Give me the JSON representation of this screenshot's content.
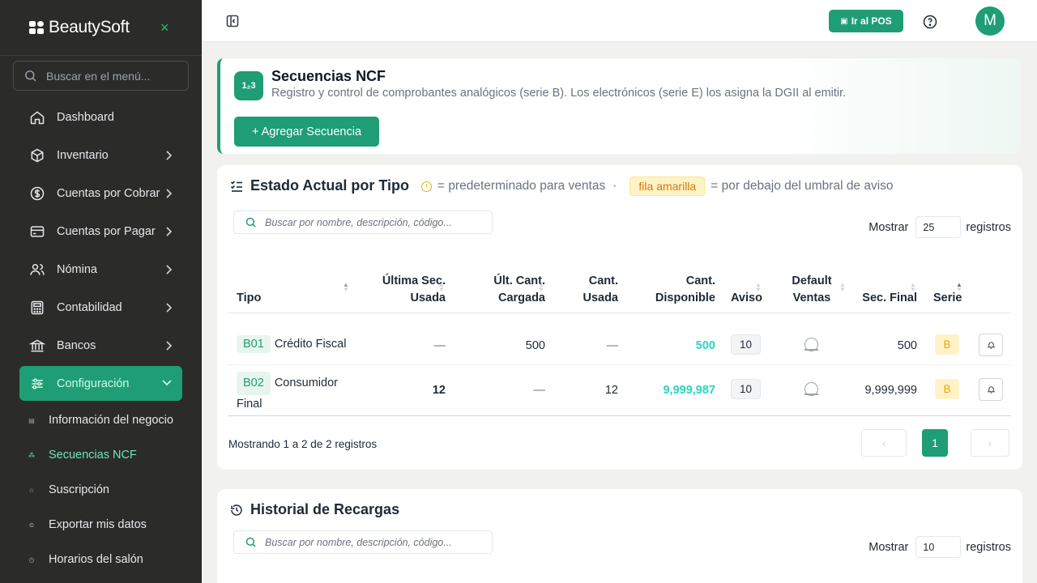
{
  "brand": {
    "name": "BeautySoft",
    "close_glyph": "×"
  },
  "menu_search": {
    "placeholder": "Buscar en el menú..."
  },
  "nav": [
    {
      "label": "Dashboard",
      "icon": "home-icon"
    },
    {
      "label": "Inventario",
      "icon": "box-icon"
    },
    {
      "label": "Cuentas por Cobrar",
      "icon": "dollar-icon"
    },
    {
      "label": "Cuentas por Pagar",
      "icon": "card-icon"
    },
    {
      "label": "Nómina",
      "icon": "users-icon"
    },
    {
      "label": "Contabilidad",
      "icon": "calculator-icon"
    },
    {
      "label": "Bancos",
      "icon": "bank-icon"
    },
    {
      "label": "Configuración",
      "icon": "sliders-icon"
    }
  ],
  "subnav": [
    {
      "label": "Información del negocio",
      "glyph": "▤"
    },
    {
      "label": "Secuencias NCF",
      "glyph": "⁂"
    },
    {
      "label": "Suscripción",
      "glyph": "☆"
    },
    {
      "label": "Exportar mis datos",
      "glyph": "⊜"
    },
    {
      "label": "Horarios del salón",
      "glyph": "◷"
    }
  ],
  "topbar": {
    "pos_label": "Ir al POS",
    "avatar_initial": "M"
  },
  "header": {
    "icon_text": "1₂3",
    "title": "Secuencias NCF",
    "subtitle": "Registro y control de comprobantes analógicos (serie B). Los electrónicos (serie E) los asigna la DGII al emitir.",
    "add_label": "+ Agregar Secuencia"
  },
  "estado": {
    "title": "Estado Actual por Tipo",
    "legend_default": "= predeterminado para ventas",
    "legend_dot": "·",
    "legend_pill": "fila amarilla",
    "legend_threshold": "= por debajo del umbral de aviso",
    "search_placeholder": "Buscar por nombre, descripción, código...",
    "show_label": "Mostrar",
    "show_value": "25",
    "records_label": "registros",
    "columns": {
      "tipo": "Tipo",
      "ultima_sec_1": "Última Sec.",
      "ultima_sec_2": "Usada",
      "ult_cant_1": "Últ. Cant.",
      "ult_cant_2": "Cargada",
      "cant_usada_1": "Cant.",
      "cant_usada_2": "Usada",
      "cant_disp_1": "Cant.",
      "cant_disp_2": "Disponible",
      "aviso": "Aviso",
      "default_1": "Default",
      "default_2": "Ventas",
      "sec_final": "Sec. Final",
      "serie": "Serie"
    },
    "rows": [
      {
        "code": "B01",
        "name": "Crédito Fiscal",
        "name2": "",
        "ultima": "—",
        "ult_cant": "500",
        "cant_usada": "—",
        "disponible": "500",
        "aviso": "10",
        "sec_final": "500",
        "serie": "B"
      },
      {
        "code": "B02",
        "name": "Consumidor",
        "name2": "Final",
        "ultima": "12",
        "ult_cant": "—",
        "cant_usada": "12",
        "disponible": "9,999,987",
        "aviso": "10",
        "sec_final": "9,999,999",
        "serie": "B"
      }
    ],
    "footer": "Mostrando 1 a 2 de 2 registros",
    "pager": {
      "prev": "‹",
      "current": "1",
      "next": "›"
    }
  },
  "historial": {
    "title": "Historial de Recargas",
    "search_placeholder": "Buscar por nombre, descripción, código...",
    "show_label": "Mostrar",
    "show_value": "10",
    "records_label": "registros"
  },
  "colors": {
    "accent": "#1f9d74",
    "sidebar": "#2b2b29",
    "highlight_text": "#2dd4bf",
    "warning": "#f59e0b"
  }
}
